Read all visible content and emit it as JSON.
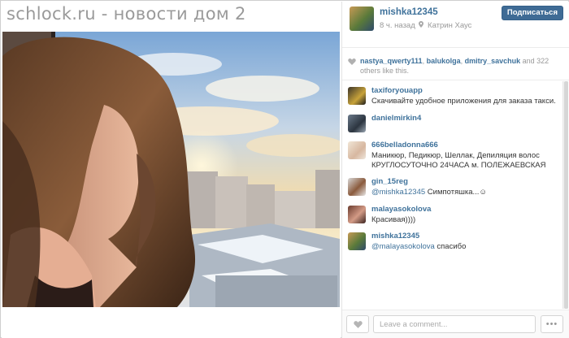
{
  "watermark": "schlock.ru - новости дом 2",
  "post": {
    "username": "mishka12345",
    "time_ago": "8 ч. назад",
    "location": "Катрин Хаус",
    "caption": "",
    "follow_label": "Подписаться"
  },
  "likes": {
    "users": [
      "nastya_qwerty111",
      "balukolga",
      "dmitry_savchuk"
    ],
    "sep1": ", ",
    "sep2": ", ",
    "rest": " and 322 others like this."
  },
  "comments": [
    {
      "user": "taxiforyouapp",
      "text": "Скачивайте удобное приложения для заказа такси."
    },
    {
      "user": "danielmirkin4",
      "text": ""
    },
    {
      "user": "666belladonna666",
      "text": "Маникюр, Педикюр, Шеллак, Депиляция волос КРУГЛОСУТОЧНО 24ЧАСА м. ПОЛЕЖАЕВСКАЯ"
    },
    {
      "user": "gin_15reg",
      "mention": "@mishka12345",
      "text": " Симпотяшка...☺"
    },
    {
      "user": "malayasokolova",
      "text": "Красивая))))"
    },
    {
      "user": "mishka12345",
      "mention": "@malayasokolova",
      "text": " спасибо"
    }
  ],
  "footer": {
    "comment_placeholder": "Leave a comment...",
    "more_label": "•••"
  },
  "colors": {
    "link": "#3f729b",
    "follow_button": "#3f6b95"
  },
  "icons": [
    "heart-icon",
    "location-pin-icon",
    "more-options-icon"
  ]
}
